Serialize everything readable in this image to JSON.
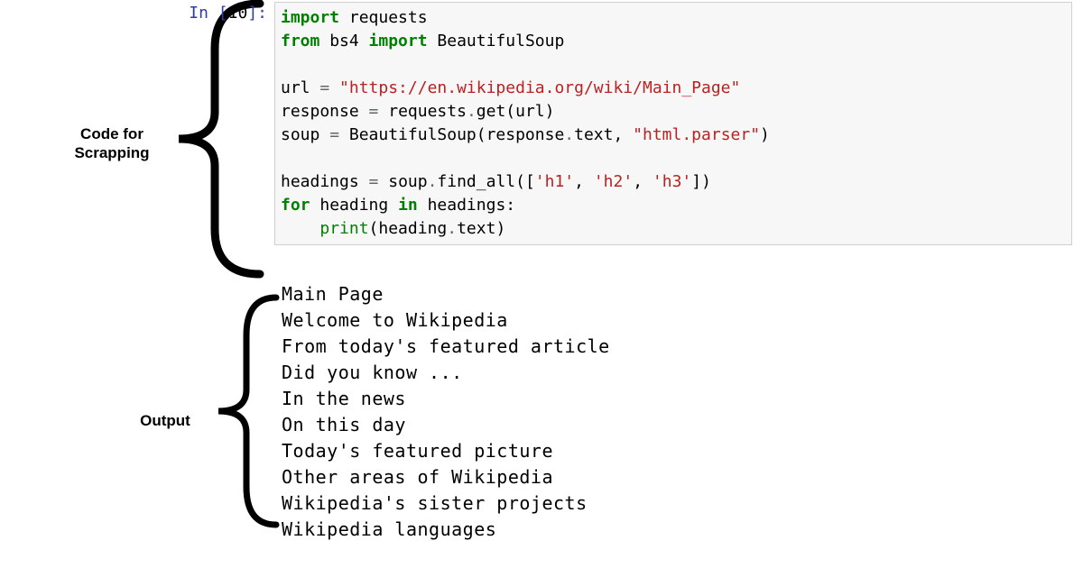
{
  "prompt": {
    "in_label": "In ",
    "open": "[",
    "number": "10",
    "close": "]:"
  },
  "annotations": {
    "code_label_l1": "Code for",
    "code_label_l2": "Scrapping",
    "output_label": "Output"
  },
  "code": {
    "l1_import": "import",
    "l1_mod": " requests",
    "l2_from": "from",
    "l2_mod": " bs4 ",
    "l2_import": "import",
    "l2_name": " BeautifulSoup",
    "l4_lhs": "url ",
    "l4_eq": "=",
    "l4_str": " \"https://en.wikipedia.org/wiki/Main_Page\"",
    "l5_lhs": "response ",
    "l5_eq": "=",
    "l5_rhs": " requests",
    "l5_dot": ".",
    "l5_get": "get(url)",
    "l6_lhs": "soup ",
    "l6_eq": "=",
    "l6_call": " BeautifulSoup(response",
    "l6_dot": ".",
    "l6_text": "text, ",
    "l6_str": "\"html.parser\"",
    "l6_close": ")",
    "l8_lhs": "headings ",
    "l8_eq": "=",
    "l8_rhs": " soup",
    "l8_dot": ".",
    "l8_fn": "find_all([",
    "l8_s1": "'h1'",
    "l8_c1": ", ",
    "l8_s2": "'h2'",
    "l8_c2": ", ",
    "l8_s3": "'h3'",
    "l8_close": "])",
    "l9_for": "for",
    "l9_var": " heading ",
    "l9_in": "in",
    "l9_iter": " headings:",
    "l10_indent": "    ",
    "l10_print": "print",
    "l10_arg": "(heading",
    "l10_dot": ".",
    "l10_text": "text)"
  },
  "output_lines": [
    "Main Page",
    "Welcome to Wikipedia",
    "From today's featured article",
    "Did you know ...",
    "In the news",
    "On this day",
    "Today's featured picture",
    "Other areas of Wikipedia",
    "Wikipedia's sister projects",
    "Wikipedia languages"
  ]
}
